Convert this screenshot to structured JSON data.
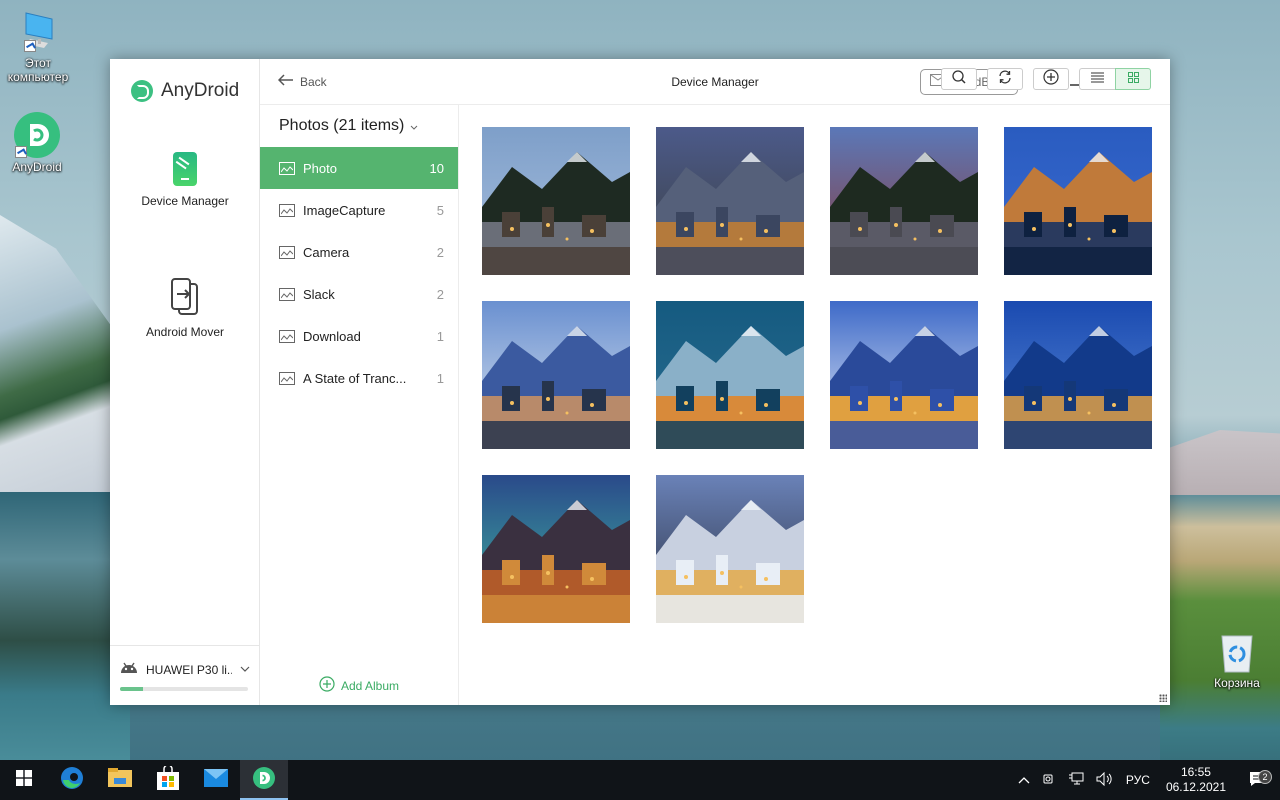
{
  "desktop": {
    "icons": [
      {
        "label": "Этот компьютер",
        "icon": "computer-icon"
      },
      {
        "label": "AnyDroid",
        "icon": "anydroid-icon"
      },
      {
        "label": "Корзина",
        "icon": "recycle-bin-icon"
      }
    ]
  },
  "app": {
    "brand": "AnyDroid",
    "brand_color": "#3cc082",
    "accent_color": "#55b46f",
    "nav": [
      {
        "label": "Device Manager",
        "icon": "device-manager-icon",
        "active": true
      },
      {
        "label": "Android Mover",
        "icon": "android-mover-icon",
        "active": false
      }
    ],
    "device": {
      "name": "HUAWEI P30 li...",
      "icon": "android-icon",
      "storage_used_fraction": 0.18
    }
  },
  "titlebar": {
    "back_label": "Back",
    "title": "Device Manager",
    "feedback_label": "FeedBack"
  },
  "albums": {
    "header": "Photos (21 items)",
    "items": [
      {
        "name": "Photo",
        "count": "10",
        "active": true
      },
      {
        "name": "ImageCapture",
        "count": "5",
        "active": false
      },
      {
        "name": "Camera",
        "count": "2",
        "active": false
      },
      {
        "name": "Slack",
        "count": "2",
        "active": false
      },
      {
        "name": "Download",
        "count": "1",
        "active": false
      },
      {
        "name": "A State of Tranc...",
        "count": "1",
        "active": false
      }
    ],
    "add_label": "Add Album"
  },
  "toolbar": {
    "buttons": [
      "search-icon",
      "refresh-icon",
      "add-icon"
    ],
    "view_modes": [
      "list-view",
      "grid-view"
    ],
    "active_view": "grid-view"
  },
  "photos": [
    {
      "desc": "Harbor town below snowy mountain at dusk",
      "colors": [
        "#7e9fc9",
        "#a9c0de",
        "#1e2a22",
        "#6a6e78",
        "#4a4038"
      ]
    },
    {
      "desc": "Aerial view of snowy town at twilight",
      "colors": [
        "#4c5a8a",
        "#3a3f40",
        "#55607a",
        "#b47a3c",
        "#3b4660"
      ]
    },
    {
      "desc": "Historic brick street with forested hill",
      "colors": [
        "#5b78b8",
        "#8a3a3a",
        "#1e2a20",
        "#5a5a66",
        "#4a4a52"
      ]
    },
    {
      "desc": "City lights at night with mountains",
      "colors": [
        "#2a5cc0",
        "#3a6ad0",
        "#c07a3a",
        "#2a3a5e",
        "#0e2140"
      ]
    },
    {
      "desc": "City with snowy peaks and buildings",
      "colors": [
        "#6a90d0",
        "#dde6f0",
        "#3b5aa0",
        "#b88a6a",
        "#26344c"
      ]
    },
    {
      "desc": "Fireworks over city skyline by water",
      "colors": [
        "#155a80",
        "#2a6e90",
        "#8ab0c8",
        "#d88a3a",
        "#12405e"
      ]
    },
    {
      "desc": "Skyline reflected in water with peaks",
      "colors": [
        "#3e6ac8",
        "#e8eef8",
        "#2a4a9a",
        "#e0a040",
        "#2e50a8"
      ]
    },
    {
      "desc": "Blue mountains behind city skyline",
      "colors": [
        "#1a4ab0",
        "#5a8ad8",
        "#123a8a",
        "#c09050",
        "#143878"
      ]
    },
    {
      "desc": "Town square with lights and northern lights",
      "colors": [
        "#2a4a8a",
        "#3fb8a0",
        "#3a3040",
        "#b05a2a",
        "#d08a3a"
      ]
    },
    {
      "desc": "Snowy rooftops in town at dusk",
      "colors": [
        "#6a82b8",
        "#2a3040",
        "#c8d0e0",
        "#e0b060",
        "#e8eef6"
      ]
    }
  ],
  "taskbar": {
    "apps": [
      {
        "name": "start",
        "icon": "windows-start-icon",
        "active": false
      },
      {
        "name": "edge",
        "icon": "edge-browser-icon",
        "active": false
      },
      {
        "name": "explorer",
        "icon": "file-explorer-icon",
        "active": false
      },
      {
        "name": "store",
        "icon": "microsoft-store-icon",
        "active": false
      },
      {
        "name": "mail",
        "icon": "mail-icon",
        "active": false
      },
      {
        "name": "anydroid",
        "icon": "anydroid-icon",
        "active": true
      }
    ],
    "language": "РУС",
    "time": "16:55",
    "date": "06.12.2021",
    "notifications": "2"
  }
}
